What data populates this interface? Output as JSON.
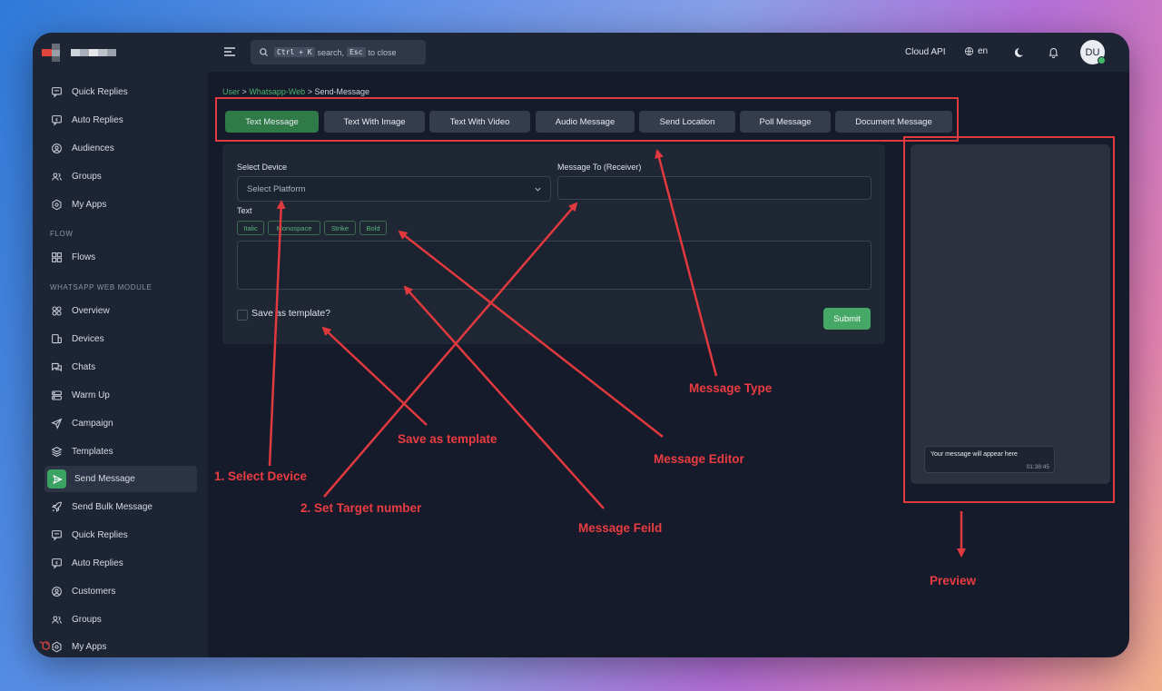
{
  "sidebar": {
    "items_top": [
      {
        "label": "Quick Replies",
        "icon": "message-square-icon"
      },
      {
        "label": "Auto Replies",
        "icon": "message-reply-icon"
      },
      {
        "label": "Audiences",
        "icon": "user-circle-icon"
      },
      {
        "label": "Groups",
        "icon": "users-icon"
      },
      {
        "label": "My Apps",
        "icon": "hexagon-icon"
      }
    ],
    "section_flow": "FLOW",
    "items_flow": [
      {
        "label": "Flows",
        "icon": "grid-icon"
      }
    ],
    "section_wa": "WHATSAPP WEB MODULE",
    "items_wa": [
      {
        "label": "Overview",
        "icon": "circles-icon"
      },
      {
        "label": "Devices",
        "icon": "devices-icon"
      },
      {
        "label": "Chats",
        "icon": "chats-icon"
      },
      {
        "label": "Warm Up",
        "icon": "server-icon"
      },
      {
        "label": "Campaign",
        "icon": "send-icon"
      },
      {
        "label": "Templates",
        "icon": "layers-icon"
      },
      {
        "label": "Send Message",
        "icon": "send-message-icon",
        "active": true
      },
      {
        "label": "Send Bulk Message",
        "icon": "rocket-icon"
      },
      {
        "label": "Quick Replies",
        "icon": "message-square-icon"
      },
      {
        "label": "Auto Replies",
        "icon": "message-reply-icon"
      },
      {
        "label": "Customers",
        "icon": "user-circle-icon"
      },
      {
        "label": "Groups",
        "icon": "users-icon"
      },
      {
        "label": "My Apps",
        "icon": "hexagon-icon"
      }
    ]
  },
  "topbar": {
    "search_kbd1": "Ctrl + K",
    "search_mid": "search,",
    "search_kbd2": "Esc",
    "search_end": "to close",
    "cloud_api": "Cloud API",
    "language": "en",
    "avatar_initials": "DU"
  },
  "breadcrumb": {
    "part1": "User",
    "part2": "Whatsapp-Web",
    "part3": "Send-Message",
    "separator": ">"
  },
  "tabs": [
    {
      "label": "Text Message",
      "active": true
    },
    {
      "label": "Text With Image"
    },
    {
      "label": "Text With Video"
    },
    {
      "label": "Audio Message"
    },
    {
      "label": "Send Location"
    },
    {
      "label": "Poll Message"
    },
    {
      "label": "Document Message"
    }
  ],
  "form": {
    "device_label": "Select Device",
    "device_placeholder": "Select Platform",
    "receiver_label": "Message To (Receiver)",
    "receiver_value": "",
    "text_label": "Text",
    "format_chips": [
      "Italic",
      "Monospace",
      "Strike",
      "Bold"
    ],
    "text_value": "",
    "save_template_label": "Save as template?",
    "submit_label": "Submit"
  },
  "preview": {
    "message": "Your message will appear here",
    "time": "01:38:45"
  },
  "annotations": {
    "select_device": "1. Select Device",
    "set_target": "2. Set Target number",
    "save_template": "Save as template",
    "message_editor": "Message Editor",
    "message_field": "Message Feild",
    "message_type": "Message Type",
    "preview": "Preview"
  },
  "colors": {
    "accent_green": "#3aa363",
    "annotation_red": "#e0393e",
    "sidebar_bg": "#1d2433",
    "content_bg": "#151b2a"
  }
}
